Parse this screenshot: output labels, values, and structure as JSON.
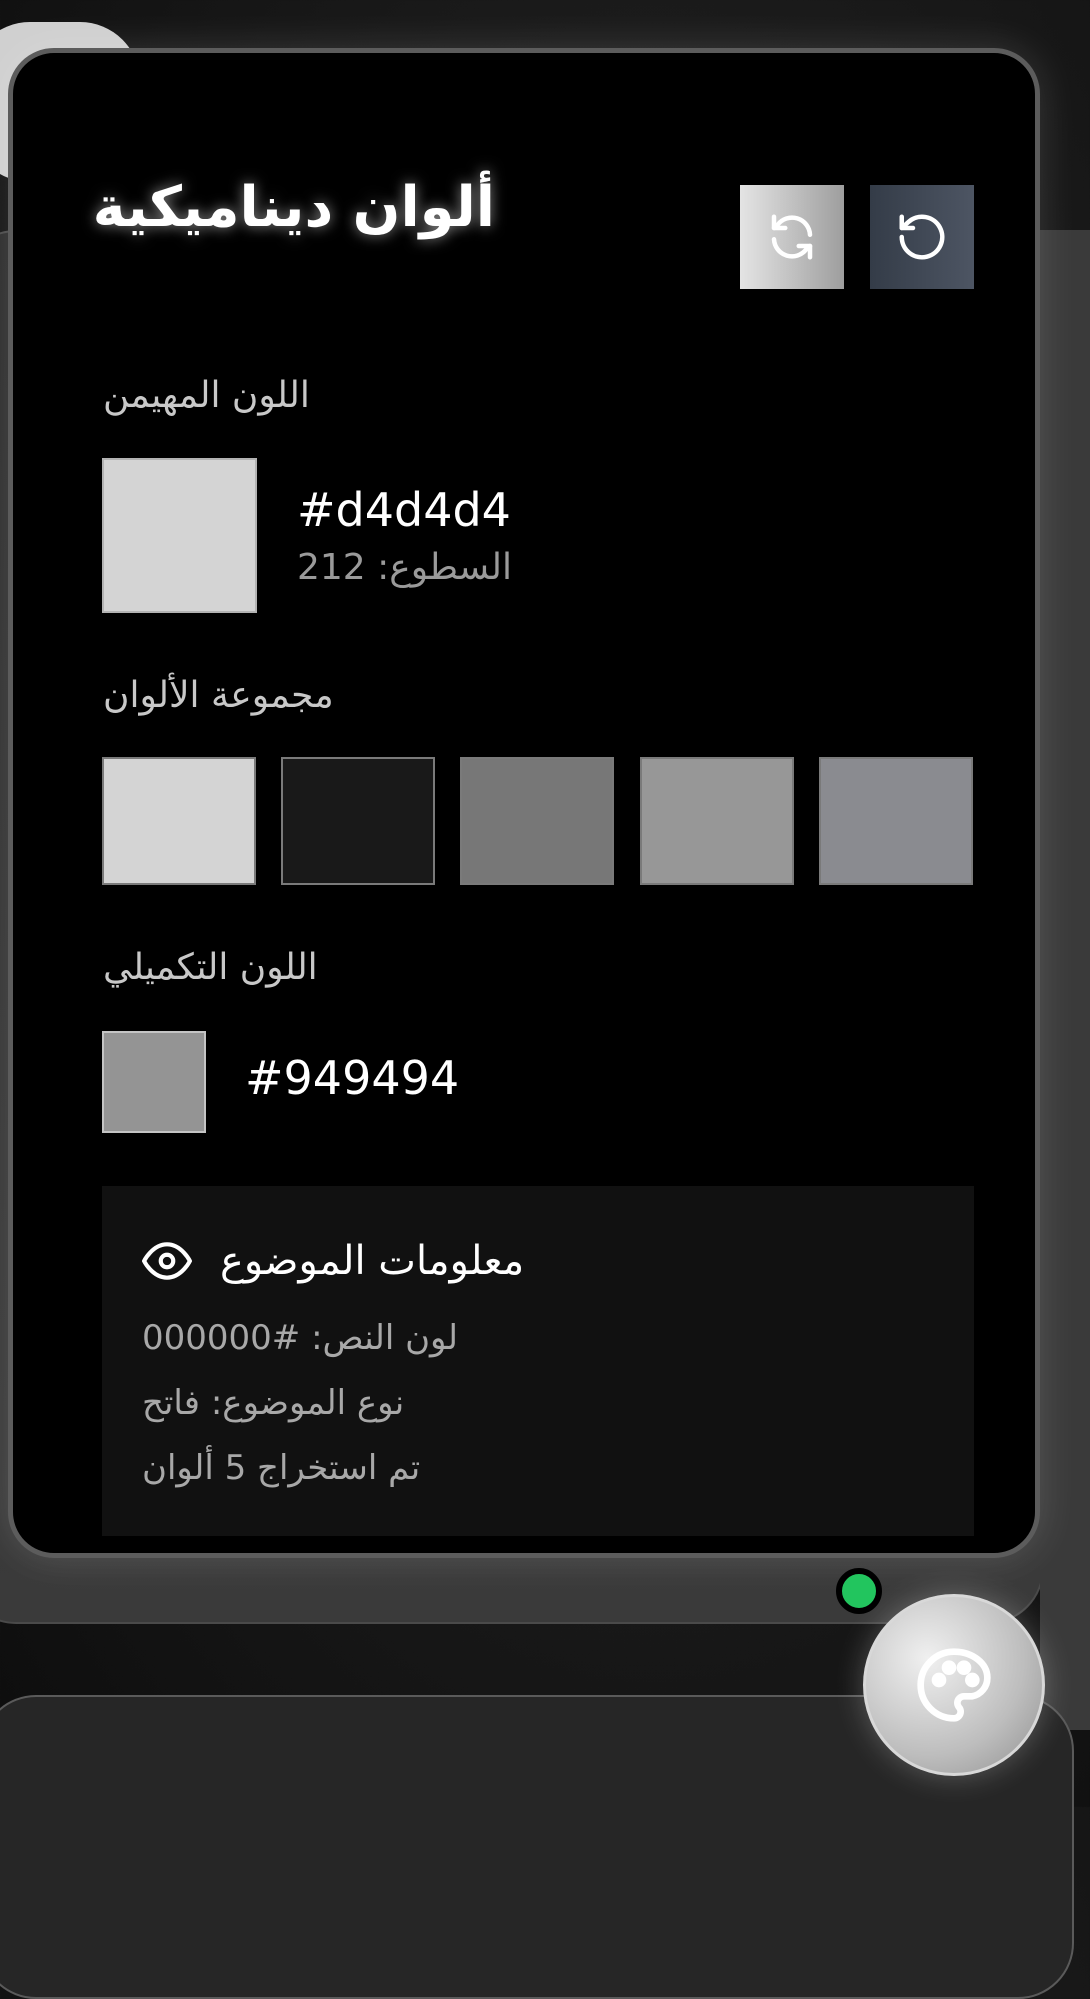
{
  "panel": {
    "title": "ألوان ديناميكية",
    "refresh_icon": "refresh-icon",
    "reset_icon": "reset-icon"
  },
  "dominant": {
    "label": "اللون المهيمن",
    "color": "#d4d4d4",
    "hex": "#d4d4d4",
    "brightness_text": "السطوع: 212"
  },
  "palette": {
    "label": "مجموعة الألوان",
    "colors": [
      "#d4d4d4",
      "#191919",
      "#777777",
      "#979797",
      "#8a8b90"
    ]
  },
  "complementary": {
    "label": "اللون التكميلي",
    "color": "#949494",
    "hex": "#949494"
  },
  "theme_info": {
    "title": "معلومات الموضوع",
    "icon": "eye-icon",
    "text_color_line": "لون النص: #000000",
    "theme_type_line": "نوع الموضوع: فاتح",
    "extracted_line": "تم استخراج 5 ألوان"
  },
  "fab": {
    "icon": "palette-icon",
    "status_color": "#22c55e"
  }
}
